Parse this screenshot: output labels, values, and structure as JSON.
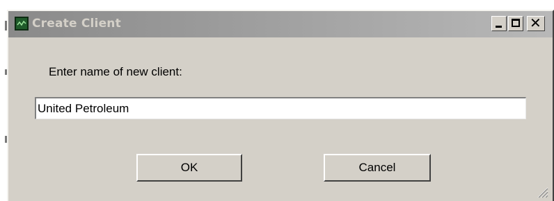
{
  "window": {
    "title": "Create Client",
    "icon": "app-graph-icon",
    "controls": {
      "minimize": "minimize-icon",
      "maximize": "maximize-icon",
      "close": "close-icon"
    }
  },
  "form": {
    "prompt": "Enter name of new client:",
    "client_name_value": "United Petroleum"
  },
  "buttons": {
    "ok_label": "OK",
    "cancel_label": "Cancel"
  },
  "colors": {
    "dialog_face": "#d4d0c8",
    "titlebar_inactive": "#9c9c9c",
    "title_text": "#d4d0c8"
  }
}
